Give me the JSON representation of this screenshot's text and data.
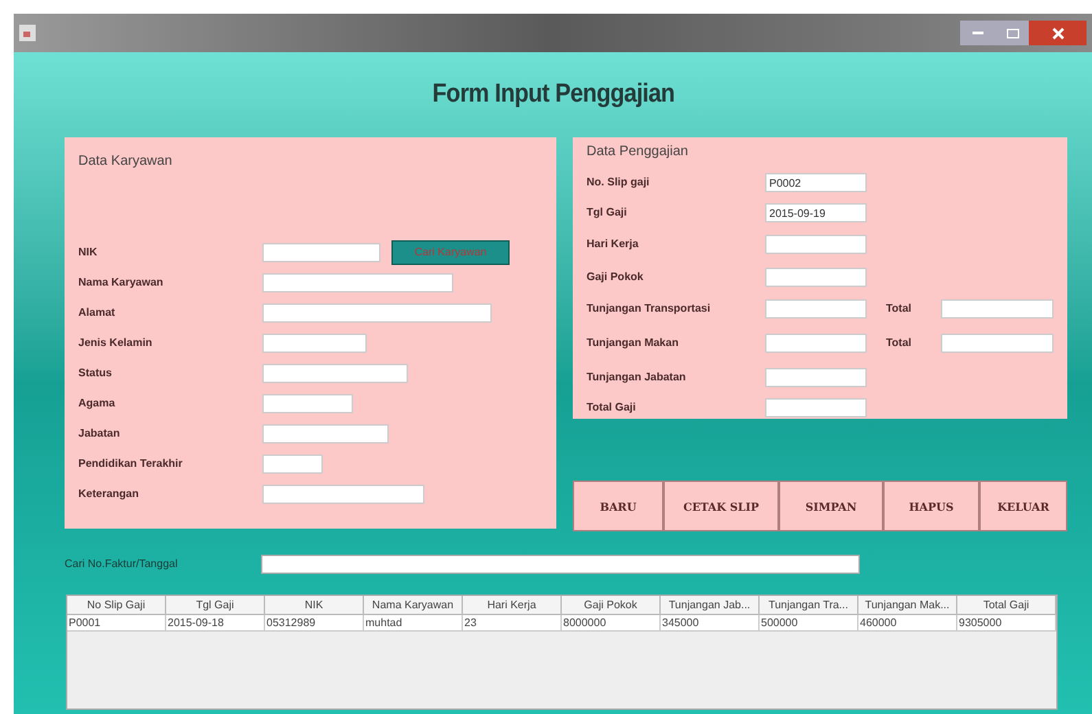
{
  "window": {
    "title": "Form Input Penggajian"
  },
  "employee_panel": {
    "title": "Data Karyawan",
    "search_button": "Cari Karyawan",
    "fields": [
      {
        "label": "NIK"
      },
      {
        "label": "Nama Karyawan"
      },
      {
        "label": "Alamat"
      },
      {
        "label": "Jenis Kelamin"
      },
      {
        "label": "Status"
      },
      {
        "label": "Agama"
      },
      {
        "label": "Jabatan"
      },
      {
        "label": "Pendidikan Terakhir"
      },
      {
        "label": "Keterangan"
      }
    ]
  },
  "salary_panel": {
    "title": "Data Penggajian",
    "fields": [
      {
        "label": "No. Slip gaji",
        "value": "P0002"
      },
      {
        "label": "Tgl Gaji",
        "value": "2015-09-19"
      },
      {
        "label": "Hari Kerja"
      },
      {
        "label": "Gaji Pokok"
      },
      {
        "label": "Tunjangan Transportasi",
        "total_label": "Total"
      },
      {
        "label": "Tunjangan Makan",
        "total_label": "Total"
      },
      {
        "label": "Tunjangan Jabatan"
      },
      {
        "label": "Total Gaji"
      }
    ]
  },
  "buttons": [
    "BARU",
    "CETAK SLIP",
    "SIMPAN",
    "HAPUS",
    "KELUAR"
  ],
  "search": {
    "label": "Cari No.Faktur/Tanggal"
  },
  "table": {
    "columns": [
      "No Slip Gaji",
      "Tgl Gaji",
      "NIK",
      "Nama Karyawan",
      "Hari Kerja",
      "Gaji Pokok",
      "Tunjangan Jab...",
      "Tunjangan Tra...",
      "Tunjangan Mak...",
      "Total Gaji"
    ],
    "rows": [
      [
        "P0001",
        "2015-09-18",
        "05312989",
        "muhtad",
        "23",
        "8000000",
        "345000",
        "500000",
        "460000",
        "9305000"
      ]
    ]
  }
}
